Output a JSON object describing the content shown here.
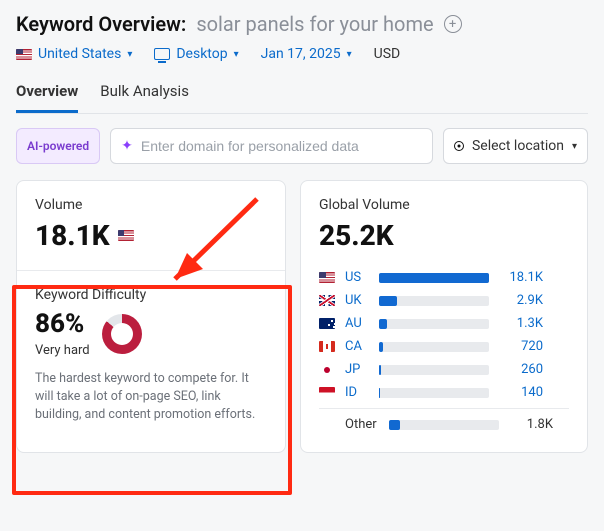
{
  "header": {
    "title_label": "Keyword Overview:",
    "keyword": "solar panels for your home"
  },
  "filters": {
    "country": "United States",
    "device": "Desktop",
    "date": "Jan 17, 2025",
    "currency": "USD"
  },
  "tabs": {
    "overview": "Overview",
    "bulk": "Bulk Analysis"
  },
  "inputs": {
    "ai_badge": "AI-powered",
    "domain_placeholder": "Enter domain for personalized data",
    "location_placeholder": "Select location"
  },
  "volume": {
    "title": "Volume",
    "value": "18.1K"
  },
  "kd": {
    "title": "Keyword Difficulty",
    "value": "86%",
    "level": "Very hard",
    "desc": "The hardest keyword to compete for. It will take a lot of on-page SEO, link building, and content promotion efforts.",
    "percent": 86
  },
  "global": {
    "title": "Global Volume",
    "value": "25.2K",
    "rows": [
      {
        "flag": "us",
        "code": "US",
        "value": "18.1K",
        "pct": 100
      },
      {
        "flag": "uk",
        "code": "UK",
        "value": "2.9K",
        "pct": 16
      },
      {
        "flag": "au",
        "code": "AU",
        "value": "1.3K",
        "pct": 7
      },
      {
        "flag": "ca",
        "code": "CA",
        "value": "720",
        "pct": 4
      },
      {
        "flag": "jp",
        "code": "JP",
        "value": "260",
        "pct": 2
      },
      {
        "flag": "id",
        "code": "ID",
        "value": "140",
        "pct": 1
      }
    ],
    "other_label": "Other",
    "other_value": "1.8K",
    "other_pct": 10
  },
  "colors": {
    "link": "#0b6bcb",
    "highlight": "#ff2a12",
    "kd_ring": "#bb1e3e"
  }
}
